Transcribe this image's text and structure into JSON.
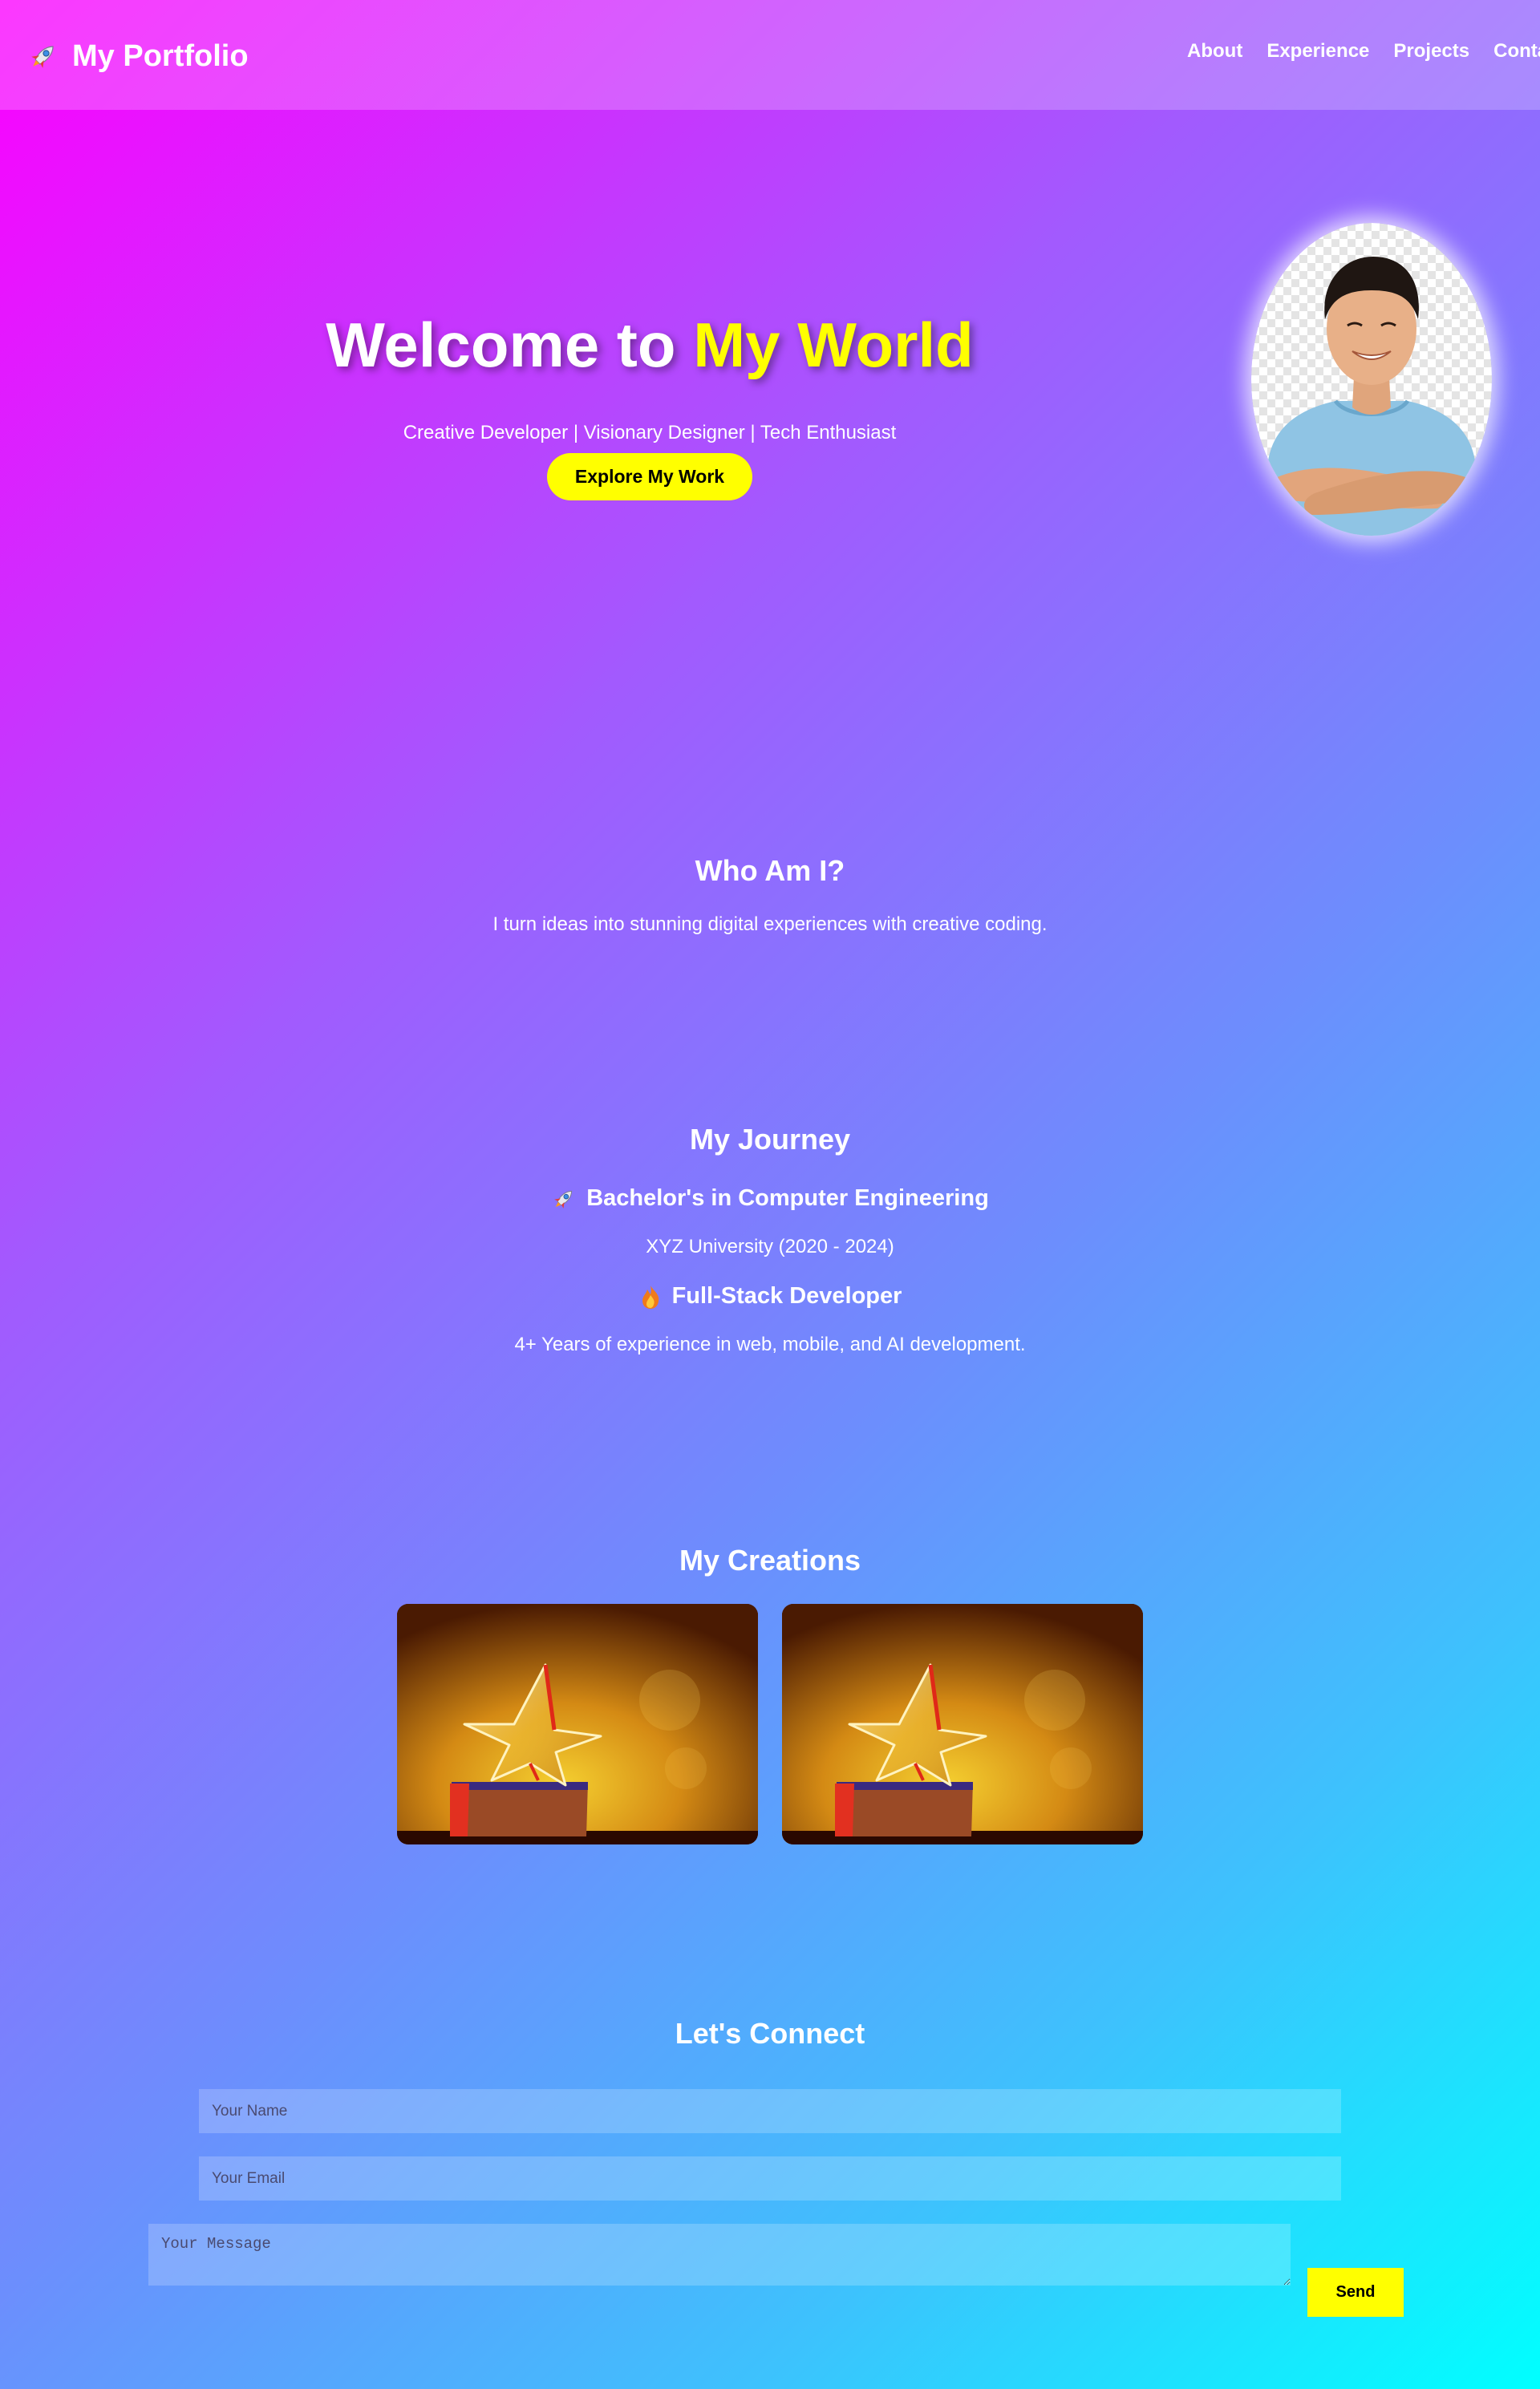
{
  "header": {
    "brand_icon": "rocket-icon",
    "brand": "My Portfolio",
    "nav": [
      "About",
      "Experience",
      "Projects",
      "Contact"
    ]
  },
  "hero": {
    "title_prefix": "Welcome to",
    "title_accent": "My World",
    "subtitle": "Creative Developer | Visionary Designer | Tech Enthusiast",
    "cta": "Explore My Work",
    "accent_color": "#ffff00"
  },
  "about": {
    "title": "Who Am I?",
    "text": "I turn ideas into stunning digital experiences with creative coding."
  },
  "journey": {
    "title": "My Journey",
    "items": [
      {
        "icon": "rocket-icon",
        "heading": "Bachelor's in Computer Engineering",
        "detail": "XYZ University (2020 - 2024)"
      },
      {
        "icon": "fire-icon",
        "heading": "Full-Stack Developer",
        "detail": "4+ Years of experience in web, mobile, and AI development."
      }
    ]
  },
  "creations": {
    "title": "My Creations",
    "cards": [
      {
        "image": "star-trophy"
      },
      {
        "image": "star-trophy"
      }
    ]
  },
  "contact": {
    "title": "Let's Connect",
    "name_placeholder": "Your Name",
    "email_placeholder": "Your Email",
    "message_placeholder": "Your Message",
    "send": "Send"
  }
}
